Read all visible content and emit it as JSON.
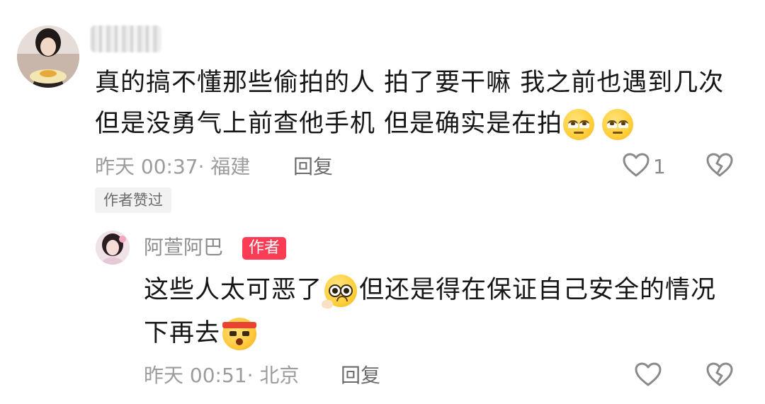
{
  "comment_main": {
    "username": "",
    "text_line1": "真的搞不懂那些偷拍的人 拍了要干嘛 我之前也遇到几次",
    "text_line2": "但是没勇气上前查他手机 但是确实是在拍",
    "time": "昨天 00:37",
    "location": "· 福建",
    "reply_label": "回复",
    "like_count": "1",
    "liked_by_author_tag": "作者赞过",
    "emojis": [
      "eye-roll-emoji",
      "eye-roll-emoji"
    ]
  },
  "comment_reply": {
    "username": "阿萱阿巴",
    "author_badge": "作者",
    "text_part1": "这些人太可恶了",
    "text_part2": "但还是得在保证自己安全的情况",
    "text_line2": "下再去",
    "time": "昨天 00:51",
    "location": "· 北京",
    "reply_label": "回复",
    "emojis": [
      "pleading-emoji",
      "fighting-emoji"
    ]
  },
  "colors": {
    "text": "#161616",
    "meta": "#9c9c9c",
    "badge": "#fa3d55",
    "tag_bg": "#f2f2f2"
  },
  "icons": {
    "like": "heart-outline-icon",
    "dislike": "broken-heart-icon"
  }
}
